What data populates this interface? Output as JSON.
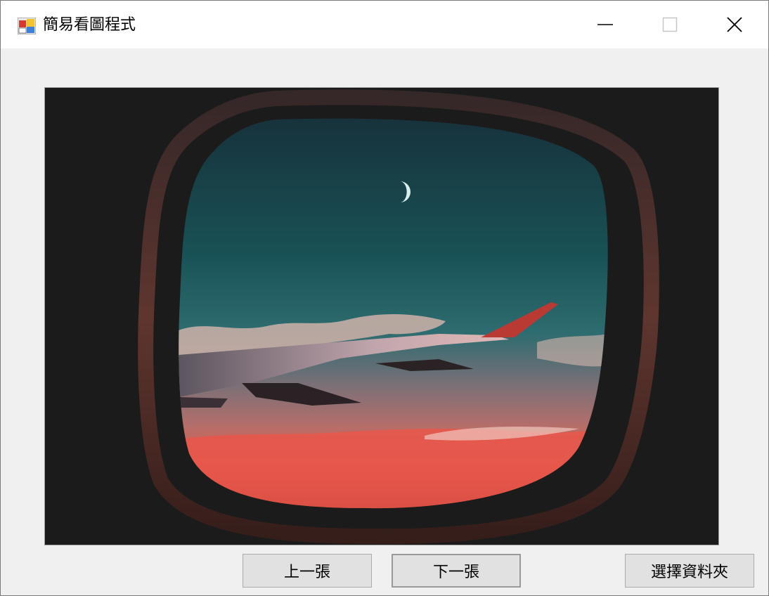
{
  "window": {
    "title": "簡易看圖程式",
    "icon": "windows-forms-app-icon",
    "controls": {
      "minimize_icon": "minimize-icon",
      "maximize_icon": "maximize-icon",
      "close_icon": "close-icon"
    }
  },
  "viewer": {
    "image_subject": "airplane-window-view-photo"
  },
  "buttons": {
    "previous_label": "上一張",
    "next_label": "下一張",
    "choose_folder_label": "選擇資料夾"
  },
  "colors": {
    "window_background": "#f0f0f0",
    "titlebar_background": "#ffffff",
    "button_background": "#e1e1e1",
    "picture_background": "#1c1c1c"
  }
}
